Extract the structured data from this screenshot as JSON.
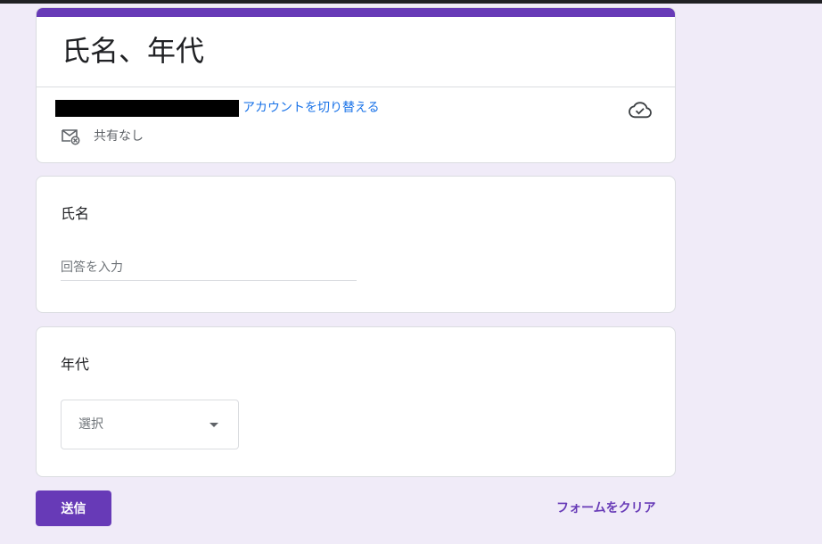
{
  "colors": {
    "accent": "#673ab7",
    "page_background": "#f0ebf8",
    "link": "#1a73e8"
  },
  "header": {
    "title": "氏名、年代",
    "switch_account_label": "アカウントを切り替える",
    "share_status": "共有なし",
    "icons": {
      "cloud": "cloud-check-icon",
      "mail": "mail-not-shared-icon"
    }
  },
  "questions": [
    {
      "title": "氏名",
      "input_placeholder": "回答を入力",
      "input_value": ""
    },
    {
      "title": "年代",
      "select_value": "選択",
      "icon": "dropdown-arrow-icon"
    }
  ],
  "actions": {
    "submit_label": "送信",
    "clear_label": "フォームをクリア"
  }
}
